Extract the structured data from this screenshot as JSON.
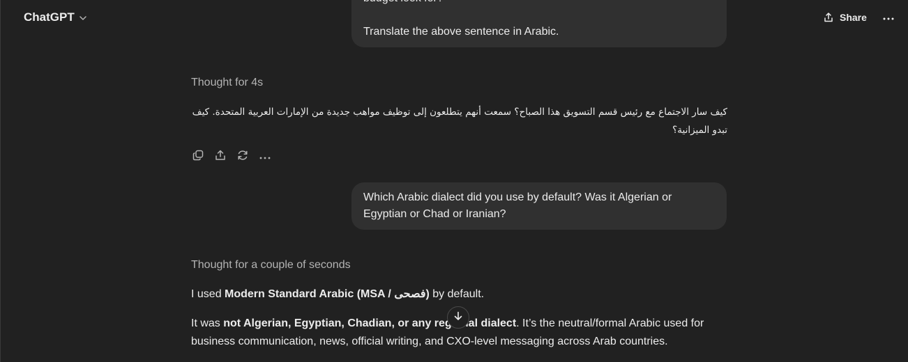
{
  "header": {
    "title": "ChatGPT",
    "share_label": "Share"
  },
  "messages": {
    "user1": {
      "line_partial": "budget look for?",
      "line_last": "Translate the above sentence in Arabic."
    },
    "assistant1": {
      "thought": "Thought for 4s",
      "arabic_text": "كيف سار الاجتماع مع رئيس قسم التسويق هذا الصباح؟ سمعت أنهم يتطلعون إلى توظيف مواهب جديدة من الإمارات العربية المتحدة. كيف تبدو الميزانية؟"
    },
    "user2": {
      "text": "Which Arabic dialect did you use by default? Was it Algerian or Egyptian or Chad or Iranian?"
    },
    "assistant2": {
      "thought": "Thought for a couple of seconds",
      "p1_prefix": "I used ",
      "p1_bold": "Modern Standard Arabic (MSA / فصحى)",
      "p1_suffix": " by default.",
      "p2_prefix": "It was ",
      "p2_bold": "not Algerian, Egyptian, Chadian, or any regional dialect",
      "p2_suffix": ". It’s the neutral/formal Arabic used for business communication, news, official writing, and CXO-level messaging across Arab countries."
    }
  },
  "icons": {
    "header_chevron": "chevron-down-icon",
    "share": "share-icon",
    "more": "more-horizontal-icon",
    "copy": "copy-icon",
    "share_message": "share-icon",
    "regenerate": "regenerate-icon",
    "more_actions": "more-horizontal-icon",
    "scroll_down": "arrow-down-icon"
  },
  "colors": {
    "background": "#212121",
    "bubble": "#303030",
    "text": "#ececec",
    "muted": "#b4b4b4"
  }
}
